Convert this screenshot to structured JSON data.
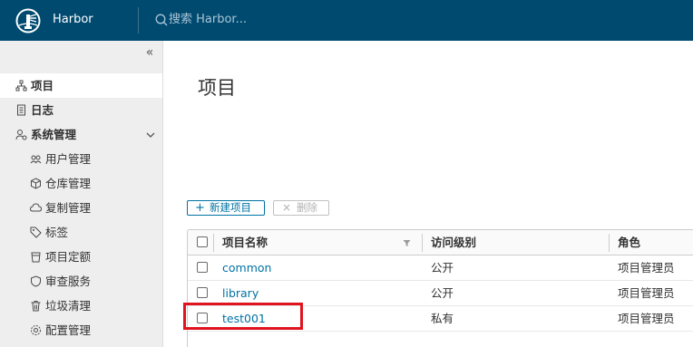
{
  "header": {
    "app_title": "Harbor",
    "search_placeholder": "搜索 Harbor..."
  },
  "sidebar": {
    "collapse_glyph": "«",
    "items": [
      {
        "label": "项目",
        "icon": "projects-icon",
        "active": true
      },
      {
        "label": "日志",
        "icon": "logs-icon"
      },
      {
        "label": "系统管理",
        "icon": "admin-icon",
        "expanded": true
      },
      {
        "label": "用户管理",
        "icon": "users-icon"
      },
      {
        "label": "仓库管理",
        "icon": "registries-icon"
      },
      {
        "label": "复制管理",
        "icon": "replication-icon"
      },
      {
        "label": "标签",
        "icon": "labels-icon"
      },
      {
        "label": "项目定额",
        "icon": "quotas-icon"
      },
      {
        "label": "审查服务",
        "icon": "interrogation-icon"
      },
      {
        "label": "垃圾清理",
        "icon": "trash-icon"
      },
      {
        "label": "配置管理",
        "icon": "config-icon"
      }
    ]
  },
  "main": {
    "title": "项目",
    "toolbar": {
      "new_label": "新建项目",
      "delete_label": "删除"
    },
    "table": {
      "columns": [
        "项目名称",
        "访问级别",
        "角色"
      ],
      "rows": [
        {
          "name": "common",
          "access": "公开",
          "role": "项目管理员"
        },
        {
          "name": "library",
          "access": "公开",
          "role": "项目管理员"
        },
        {
          "name": "test001",
          "access": "私有",
          "role": "项目管理员"
        }
      ]
    }
  },
  "colors": {
    "header_bg": "#004a70",
    "link": "#0072a3",
    "highlight": "#e0141e"
  }
}
